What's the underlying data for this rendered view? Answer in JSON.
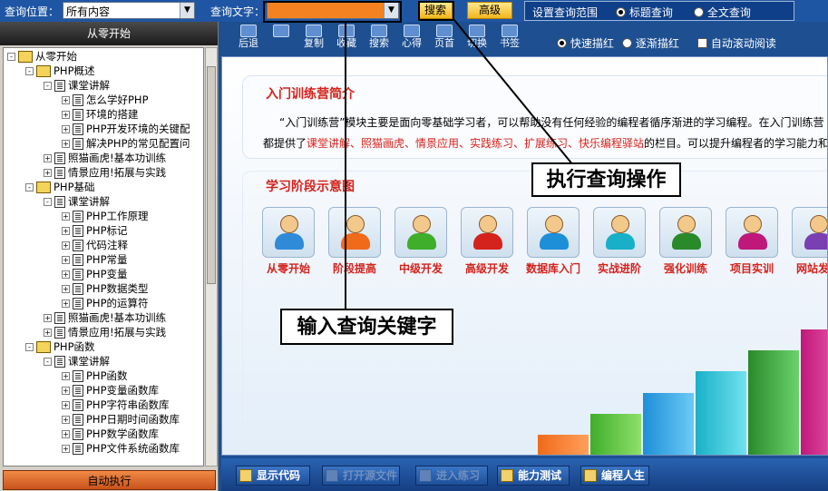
{
  "top": {
    "location_label": "查询位置：",
    "location_value": "所有内容",
    "query_label": "查询文字：",
    "query_value": "",
    "search_btn": "搜索",
    "advanced_btn": "高级",
    "scope_label": "设置查询范围",
    "scope_title": "标题查询",
    "scope_full": "全文查询"
  },
  "left": {
    "header": "从零开始",
    "autorun": "自动执行",
    "tree": [
      {
        "label": "从零开始",
        "lvl": 0,
        "pm": "-",
        "icon": "book"
      },
      {
        "label": "PHP概述",
        "lvl": 1,
        "pm": "-",
        "icon": "book"
      },
      {
        "label": "课堂讲解",
        "lvl": 2,
        "pm": "-",
        "icon": "page"
      },
      {
        "label": "怎么学好PHP",
        "lvl": 3,
        "pm": "+",
        "icon": "page"
      },
      {
        "label": "环境的搭建",
        "lvl": 3,
        "pm": "+",
        "icon": "page"
      },
      {
        "label": "PHP开发环境的关键配",
        "lvl": 3,
        "pm": "+",
        "icon": "page"
      },
      {
        "label": "解决PHP的常见配置问",
        "lvl": 3,
        "pm": "+",
        "icon": "page"
      },
      {
        "label": "照猫画虎!基本功训练",
        "lvl": 2,
        "pm": "+",
        "icon": "page"
      },
      {
        "label": "情景应用!拓展与实践",
        "lvl": 2,
        "pm": "+",
        "icon": "page"
      },
      {
        "label": "PHP基础",
        "lvl": 1,
        "pm": "-",
        "icon": "book"
      },
      {
        "label": "课堂讲解",
        "lvl": 2,
        "pm": "-",
        "icon": "page"
      },
      {
        "label": "PHP工作原理",
        "lvl": 3,
        "pm": "+",
        "icon": "page"
      },
      {
        "label": "PHP标记",
        "lvl": 3,
        "pm": "+",
        "icon": "page"
      },
      {
        "label": "代码注释",
        "lvl": 3,
        "pm": "+",
        "icon": "page"
      },
      {
        "label": "PHP常量",
        "lvl": 3,
        "pm": "+",
        "icon": "page"
      },
      {
        "label": "PHP变量",
        "lvl": 3,
        "pm": "+",
        "icon": "page"
      },
      {
        "label": "PHP数据类型",
        "lvl": 3,
        "pm": "+",
        "icon": "page"
      },
      {
        "label": "PHP的运算符",
        "lvl": 3,
        "pm": "+",
        "icon": "page"
      },
      {
        "label": "照猫画虎!基本功训练",
        "lvl": 2,
        "pm": "+",
        "icon": "page"
      },
      {
        "label": "情景应用!拓展与实践",
        "lvl": 2,
        "pm": "+",
        "icon": "page"
      },
      {
        "label": "PHP函数",
        "lvl": 1,
        "pm": "-",
        "icon": "book"
      },
      {
        "label": "课堂讲解",
        "lvl": 2,
        "pm": "-",
        "icon": "page"
      },
      {
        "label": "PHP函数",
        "lvl": 3,
        "pm": "+",
        "icon": "page"
      },
      {
        "label": "PHP变量函数库",
        "lvl": 3,
        "pm": "+",
        "icon": "page"
      },
      {
        "label": "PHP字符串函数库",
        "lvl": 3,
        "pm": "+",
        "icon": "page"
      },
      {
        "label": "PHP日期时间函数库",
        "lvl": 3,
        "pm": "+",
        "icon": "page"
      },
      {
        "label": "PHP数学函数库",
        "lvl": 3,
        "pm": "+",
        "icon": "page"
      },
      {
        "label": "PHP文件系统函数库",
        "lvl": 3,
        "pm": "+",
        "icon": "page"
      }
    ]
  },
  "toolbar": {
    "buttons": [
      "后退",
      "",
      "复制",
      "收藏",
      "搜索",
      "心得",
      "页首",
      "切换",
      "书签"
    ],
    "fast_mark": "快速描红",
    "gradual_mark": "逐渐描红",
    "auto_scroll": "自动滚动阅读"
  },
  "intro": {
    "title": "入门训练营简介",
    "line1": "“入门训练营”模块主要是面向零基础学习者，可以帮助没有任何经验的编程者循序渐进的学习编程。在入门训练营",
    "line2_a": "都提供了",
    "line2_red": "课堂讲解、照猫画虎、情景应用、实践练习、扩展练习、快乐编程驿站",
    "line2_b": "的栏目。可以提升编程者的学习能力和继"
  },
  "stages": {
    "title": "学习阶段示意图",
    "items": [
      "从零开始",
      "阶段提高",
      "中级开发",
      "高级开发",
      "数据库入门",
      "实战进阶",
      "强化训练",
      "项目实训",
      "网站发布"
    ]
  },
  "bottom": {
    "show_code": "显示代码",
    "open_source": "打开源文件",
    "exercise_link": "进入练习",
    "ability_test": "能力测试",
    "programming_life": "编程人生"
  },
  "callouts": {
    "execute": "执行查询操作",
    "input": "输入查询关键字"
  }
}
